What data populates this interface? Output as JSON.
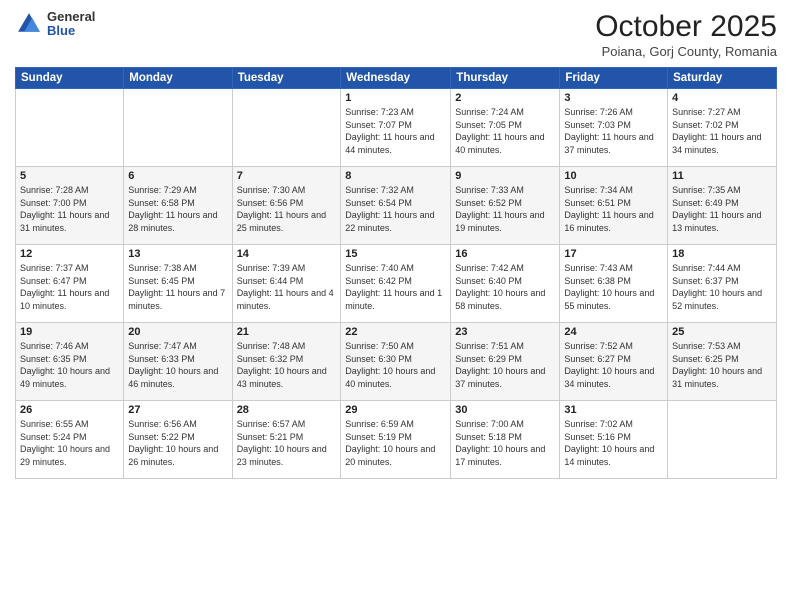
{
  "header": {
    "logo": {
      "general": "General",
      "blue": "Blue"
    },
    "title": "October 2025",
    "location": "Poiana, Gorj County, Romania"
  },
  "weekdays": [
    "Sunday",
    "Monday",
    "Tuesday",
    "Wednesday",
    "Thursday",
    "Friday",
    "Saturday"
  ],
  "weeks": [
    [
      {
        "day": "",
        "info": ""
      },
      {
        "day": "",
        "info": ""
      },
      {
        "day": "",
        "info": ""
      },
      {
        "day": "1",
        "info": "Sunrise: 7:23 AM\nSunset: 7:07 PM\nDaylight: 11 hours\nand 44 minutes."
      },
      {
        "day": "2",
        "info": "Sunrise: 7:24 AM\nSunset: 7:05 PM\nDaylight: 11 hours\nand 40 minutes."
      },
      {
        "day": "3",
        "info": "Sunrise: 7:26 AM\nSunset: 7:03 PM\nDaylight: 11 hours\nand 37 minutes."
      },
      {
        "day": "4",
        "info": "Sunrise: 7:27 AM\nSunset: 7:02 PM\nDaylight: 11 hours\nand 34 minutes."
      }
    ],
    [
      {
        "day": "5",
        "info": "Sunrise: 7:28 AM\nSunset: 7:00 PM\nDaylight: 11 hours\nand 31 minutes."
      },
      {
        "day": "6",
        "info": "Sunrise: 7:29 AM\nSunset: 6:58 PM\nDaylight: 11 hours\nand 28 minutes."
      },
      {
        "day": "7",
        "info": "Sunrise: 7:30 AM\nSunset: 6:56 PM\nDaylight: 11 hours\nand 25 minutes."
      },
      {
        "day": "8",
        "info": "Sunrise: 7:32 AM\nSunset: 6:54 PM\nDaylight: 11 hours\nand 22 minutes."
      },
      {
        "day": "9",
        "info": "Sunrise: 7:33 AM\nSunset: 6:52 PM\nDaylight: 11 hours\nand 19 minutes."
      },
      {
        "day": "10",
        "info": "Sunrise: 7:34 AM\nSunset: 6:51 PM\nDaylight: 11 hours\nand 16 minutes."
      },
      {
        "day": "11",
        "info": "Sunrise: 7:35 AM\nSunset: 6:49 PM\nDaylight: 11 hours\nand 13 minutes."
      }
    ],
    [
      {
        "day": "12",
        "info": "Sunrise: 7:37 AM\nSunset: 6:47 PM\nDaylight: 11 hours\nand 10 minutes."
      },
      {
        "day": "13",
        "info": "Sunrise: 7:38 AM\nSunset: 6:45 PM\nDaylight: 11 hours\nand 7 minutes."
      },
      {
        "day": "14",
        "info": "Sunrise: 7:39 AM\nSunset: 6:44 PM\nDaylight: 11 hours\nand 4 minutes."
      },
      {
        "day": "15",
        "info": "Sunrise: 7:40 AM\nSunset: 6:42 PM\nDaylight: 11 hours\nand 1 minute."
      },
      {
        "day": "16",
        "info": "Sunrise: 7:42 AM\nSunset: 6:40 PM\nDaylight: 10 hours\nand 58 minutes."
      },
      {
        "day": "17",
        "info": "Sunrise: 7:43 AM\nSunset: 6:38 PM\nDaylight: 10 hours\nand 55 minutes."
      },
      {
        "day": "18",
        "info": "Sunrise: 7:44 AM\nSunset: 6:37 PM\nDaylight: 10 hours\nand 52 minutes."
      }
    ],
    [
      {
        "day": "19",
        "info": "Sunrise: 7:46 AM\nSunset: 6:35 PM\nDaylight: 10 hours\nand 49 minutes."
      },
      {
        "day": "20",
        "info": "Sunrise: 7:47 AM\nSunset: 6:33 PM\nDaylight: 10 hours\nand 46 minutes."
      },
      {
        "day": "21",
        "info": "Sunrise: 7:48 AM\nSunset: 6:32 PM\nDaylight: 10 hours\nand 43 minutes."
      },
      {
        "day": "22",
        "info": "Sunrise: 7:50 AM\nSunset: 6:30 PM\nDaylight: 10 hours\nand 40 minutes."
      },
      {
        "day": "23",
        "info": "Sunrise: 7:51 AM\nSunset: 6:29 PM\nDaylight: 10 hours\nand 37 minutes."
      },
      {
        "day": "24",
        "info": "Sunrise: 7:52 AM\nSunset: 6:27 PM\nDaylight: 10 hours\nand 34 minutes."
      },
      {
        "day": "25",
        "info": "Sunrise: 7:53 AM\nSunset: 6:25 PM\nDaylight: 10 hours\nand 31 minutes."
      }
    ],
    [
      {
        "day": "26",
        "info": "Sunrise: 6:55 AM\nSunset: 5:24 PM\nDaylight: 10 hours\nand 29 minutes."
      },
      {
        "day": "27",
        "info": "Sunrise: 6:56 AM\nSunset: 5:22 PM\nDaylight: 10 hours\nand 26 minutes."
      },
      {
        "day": "28",
        "info": "Sunrise: 6:57 AM\nSunset: 5:21 PM\nDaylight: 10 hours\nand 23 minutes."
      },
      {
        "day": "29",
        "info": "Sunrise: 6:59 AM\nSunset: 5:19 PM\nDaylight: 10 hours\nand 20 minutes."
      },
      {
        "day": "30",
        "info": "Sunrise: 7:00 AM\nSunset: 5:18 PM\nDaylight: 10 hours\nand 17 minutes."
      },
      {
        "day": "31",
        "info": "Sunrise: 7:02 AM\nSunset: 5:16 PM\nDaylight: 10 hours\nand 14 minutes."
      },
      {
        "day": "",
        "info": ""
      }
    ]
  ]
}
